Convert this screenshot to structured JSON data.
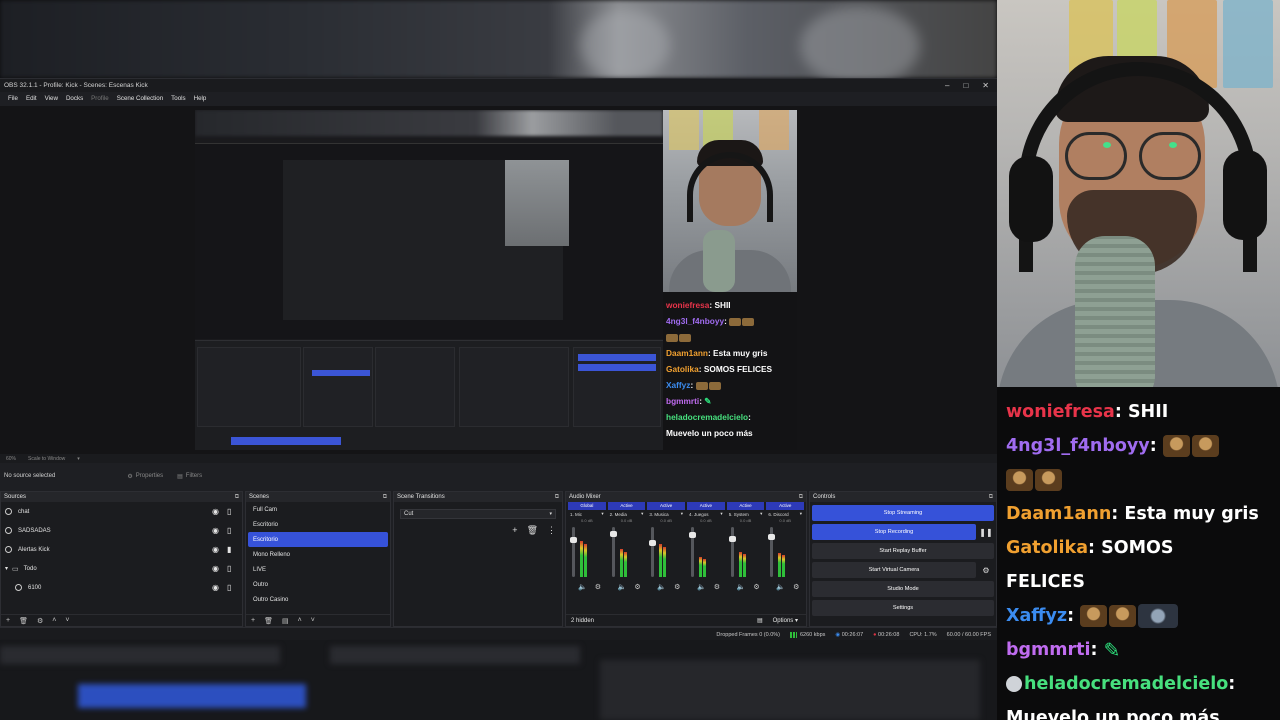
{
  "window": {
    "title": "OBS 32.1.1 - Profile: Kick - Scenes: Escenas Kick",
    "controls": [
      "–",
      "□",
      "✕"
    ]
  },
  "menu": [
    "File",
    "Edit",
    "View",
    "Docks",
    "Profile",
    "Scene Collection",
    "Tools",
    "Help"
  ],
  "zoom": {
    "percent": "60%",
    "mode": "Scale to Window"
  },
  "selection": {
    "label": "No source selected",
    "properties": "Properties",
    "filters": "Filters"
  },
  "sources": {
    "title": "Sources",
    "items": [
      {
        "name": "chat"
      },
      {
        "name": "SADSADAS"
      },
      {
        "name": "Alertas Kick"
      },
      {
        "name": "Todo"
      },
      {
        "name": "6100"
      }
    ]
  },
  "scenes": {
    "title": "Scenes",
    "items": [
      "Full Cam",
      "Escritorio",
      "Escritorio",
      "Mono Relleno",
      "LIVE",
      "Outro",
      "Outro Casino"
    ],
    "active_index": 2
  },
  "transitions": {
    "title": "Scene Transitions",
    "selected": "Cut"
  },
  "mixer": {
    "title": "Audio Mixer",
    "channels": [
      {
        "header": "Global",
        "name": "1. Mic",
        "db": "0.0 dB",
        "level": 0.72,
        "knob": 0.22
      },
      {
        "header": "Active",
        "name": "2. Media",
        "db": "0.0 dB",
        "level": 0.55,
        "knob": 0.1
      },
      {
        "header": "Active",
        "name": "3. Musica",
        "db": "0.0 dB",
        "level": 0.65,
        "knob": 0.3
      },
      {
        "header": "Active",
        "name": "4. Juegos",
        "db": "0.0 dB",
        "level": 0.4,
        "knob": 0.12
      },
      {
        "header": "Active",
        "name": "5. System",
        "db": "0.0 dB",
        "level": 0.5,
        "knob": 0.2
      },
      {
        "header": "Active",
        "name": "6. Discord",
        "db": "0.0 dB",
        "level": 0.48,
        "knob": 0.15
      }
    ],
    "hidden": "2 hidden",
    "options": "Options"
  },
  "controls": {
    "title": "Controls",
    "stop_streaming": "Stop Streaming",
    "stop_recording": "Stop Recording",
    "replay_buffer": "Start Replay Buffer",
    "virtual_camera": "Start Virtual Camera",
    "studio_mode": "Studio Mode",
    "settings": "Settings"
  },
  "status": {
    "dropped": "Dropped Frames 0 (0.0%)",
    "bitrate": "6260 kbps",
    "stream_time": "00:26:07",
    "rec_time": "00:26:08",
    "cpu": "CPU: 1.7%",
    "fps": "60.00 / 60.00 FPS"
  },
  "chat": [
    {
      "user": "woniefresa",
      "color": "#e8344a",
      "msg": "SHII"
    },
    {
      "user": "4ng3l_f4nboyy",
      "color": "#a06cf0",
      "msg": ""
    },
    {
      "user": "Daam1ann",
      "color": "#f0a030",
      "msg": "Esta muy gris"
    },
    {
      "user": "Gatolika",
      "color": "#f0a030",
      "msg": "SOMOS FELICES"
    },
    {
      "user": "Xaffyz",
      "color": "#3b8cf0",
      "msg": ""
    },
    {
      "user": "bgmmrti",
      "color": "#c06cf0",
      "msg": ""
    },
    {
      "user": "heladocremadelcielo",
      "color": "#47e07e",
      "msg": "Muevelo un poco más"
    }
  ]
}
